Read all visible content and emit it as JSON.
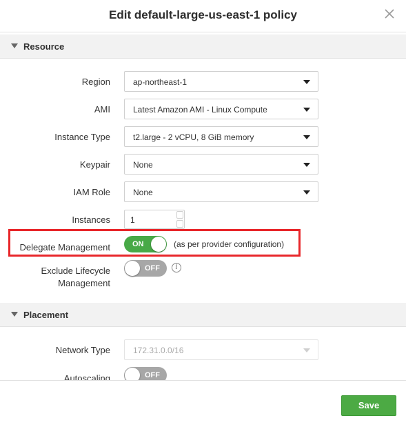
{
  "dialog": {
    "title": "Edit default-large-us-east-1 policy"
  },
  "sections": {
    "resource": "Resource",
    "placement": "Placement"
  },
  "fields": {
    "region": {
      "label": "Region",
      "value": "ap-northeast-1"
    },
    "ami": {
      "label": "AMI",
      "value": "Latest Amazon AMI - Linux Compute"
    },
    "instance_type": {
      "label": "Instance Type",
      "value": "t2.large - 2 vCPU, 8 GiB memory"
    },
    "keypair": {
      "label": "Keypair",
      "value": "None"
    },
    "iam_role": {
      "label": "IAM Role",
      "value": "None"
    },
    "instances": {
      "label": "Instances",
      "value": "1"
    },
    "delegate_management": {
      "label": "Delegate Management",
      "state": "ON",
      "note": "(as per provider configuration)"
    },
    "exclude_lifecycle": {
      "label_line1": "Exclude Lifecycle",
      "label_line2": "Management",
      "state": "OFF",
      "info_glyph": "i"
    },
    "network_type": {
      "label": "Network Type",
      "value": "172.31.0.0/16"
    },
    "autoscaling": {
      "label": "Autoscaling",
      "state": "OFF"
    }
  },
  "footer": {
    "save_label": "Save"
  },
  "colors": {
    "toggle_on": "#48a947",
    "toggle_off": "#a7a7a7",
    "save": "#4caa44",
    "highlight": "#e8262a"
  }
}
